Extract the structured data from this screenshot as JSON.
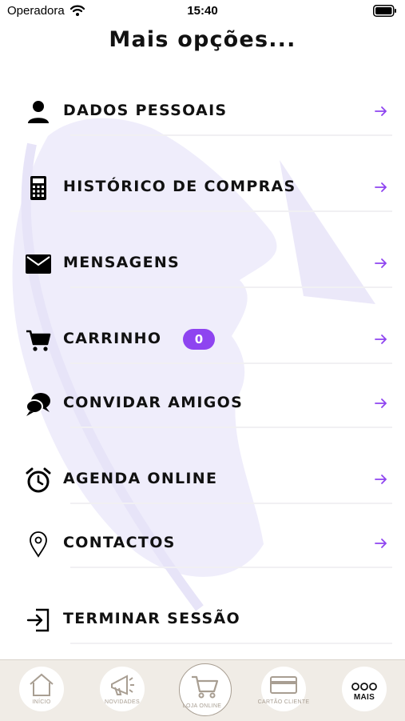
{
  "status_bar": {
    "carrier": "Operadora",
    "time": "15:40"
  },
  "title": "Mais opções...",
  "accent_color": "#8e44f0",
  "menu": [
    {
      "label": "DADOS PESSOAIS",
      "icon": "person-icon"
    },
    {
      "label": "HISTÓRICO DE COMPRAS",
      "icon": "calculator-icon"
    },
    {
      "label": "MENSAGENS",
      "icon": "envelope-icon"
    },
    {
      "label": "CARRINHO",
      "icon": "cart-icon",
      "badge": "0"
    },
    {
      "label": "CONVIDAR AMIGOS",
      "icon": "chat-bubbles-icon"
    },
    {
      "label": "AGENDA ONLINE",
      "icon": "alarm-clock-icon"
    },
    {
      "label": "CONTACTOS",
      "icon": "location-pin-icon"
    },
    {
      "label": "TERMINAR SESSÃO",
      "icon": "logout-icon"
    }
  ],
  "tabs": [
    {
      "label": "INÍCIO",
      "icon": "home-icon"
    },
    {
      "label": "NOVIDADES",
      "icon": "megaphone-icon"
    },
    {
      "label": "LOJA ONLINE",
      "icon": "cart-icon"
    },
    {
      "label": "CARTÃO CLIENTE",
      "icon": "card-icon"
    },
    {
      "label": "MAIS",
      "icon": "more-dots-icon"
    }
  ]
}
